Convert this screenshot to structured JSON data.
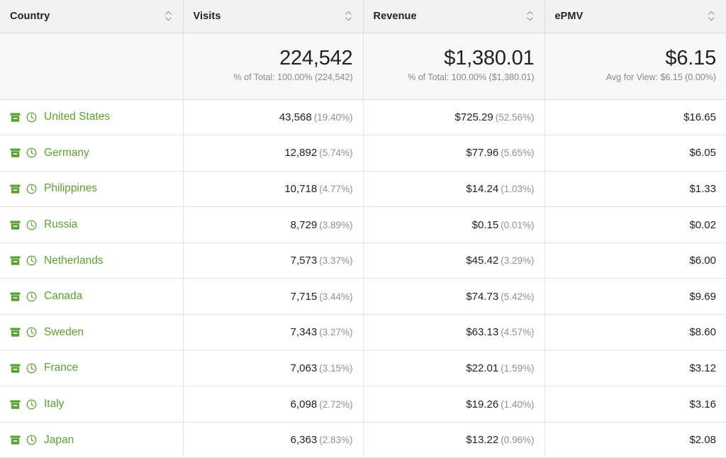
{
  "table": {
    "columns": [
      {
        "key": "country",
        "label": "Country",
        "align": "left",
        "sort_icon": "sort-chevrons-icon"
      },
      {
        "key": "visits",
        "label": "Visits",
        "align": "right",
        "sort_icon": "sort-chevrons-icon"
      },
      {
        "key": "revenue",
        "label": "Revenue",
        "align": "right",
        "sort_icon": "sort-chevrons-icon"
      },
      {
        "key": "epmv",
        "label": "ePMV",
        "align": "right",
        "sort_icon": "sort-chevrons-icon"
      }
    ],
    "summary": {
      "country": "",
      "visits": {
        "value": "224,542",
        "note": "% of Total: 100.00% (224,542)"
      },
      "revenue": {
        "value": "$1,380.01",
        "note": "% of Total: 100.00% ($1,380.01)"
      },
      "epmv": {
        "value": "$6.15",
        "note": "Avg for View: $6.15 (0.00%)"
      }
    },
    "row_icons": [
      "segment-box-icon",
      "clock-icon"
    ],
    "rows": [
      {
        "country": "United States",
        "visits": "43,568",
        "visits_pct": "(19.40%)",
        "revenue": "$725.29",
        "revenue_pct": "(52.56%)",
        "epmv": "$16.65"
      },
      {
        "country": "Germany",
        "visits": "12,892",
        "visits_pct": "(5.74%)",
        "revenue": "$77.96",
        "revenue_pct": "(5.65%)",
        "epmv": "$6.05"
      },
      {
        "country": "Philippines",
        "visits": "10,718",
        "visits_pct": "(4.77%)",
        "revenue": "$14.24",
        "revenue_pct": "(1.03%)",
        "epmv": "$1.33"
      },
      {
        "country": "Russia",
        "visits": "8,729",
        "visits_pct": "(3.89%)",
        "revenue": "$0.15",
        "revenue_pct": "(0.01%)",
        "epmv": "$0.02"
      },
      {
        "country": "Netherlands",
        "visits": "7,573",
        "visits_pct": "(3.37%)",
        "revenue": "$45.42",
        "revenue_pct": "(3.29%)",
        "epmv": "$6.00"
      },
      {
        "country": "Canada",
        "visits": "7,715",
        "visits_pct": "(3.44%)",
        "revenue": "$74.73",
        "revenue_pct": "(5.42%)",
        "epmv": "$9.69"
      },
      {
        "country": "Sweden",
        "visits": "7,343",
        "visits_pct": "(3.27%)",
        "revenue": "$63.13",
        "revenue_pct": "(4.57%)",
        "epmv": "$8.60"
      },
      {
        "country": "France",
        "visits": "7,063",
        "visits_pct": "(3.15%)",
        "revenue": "$22.01",
        "revenue_pct": "(1.59%)",
        "epmv": "$3.12"
      },
      {
        "country": "Italy",
        "visits": "6,098",
        "visits_pct": "(2.72%)",
        "revenue": "$19.26",
        "revenue_pct": "(1.40%)",
        "epmv": "$3.16"
      },
      {
        "country": "Japan",
        "visits": "6,363",
        "visits_pct": "(2.83%)",
        "revenue": "$13.22",
        "revenue_pct": "(0.96%)",
        "epmv": "$2.08"
      }
    ]
  },
  "colors": {
    "link_green": "#5aa130",
    "header_bg": "#f2f2f2",
    "summary_bg": "#f8f8f8",
    "text": "#222222",
    "muted": "#909090"
  }
}
